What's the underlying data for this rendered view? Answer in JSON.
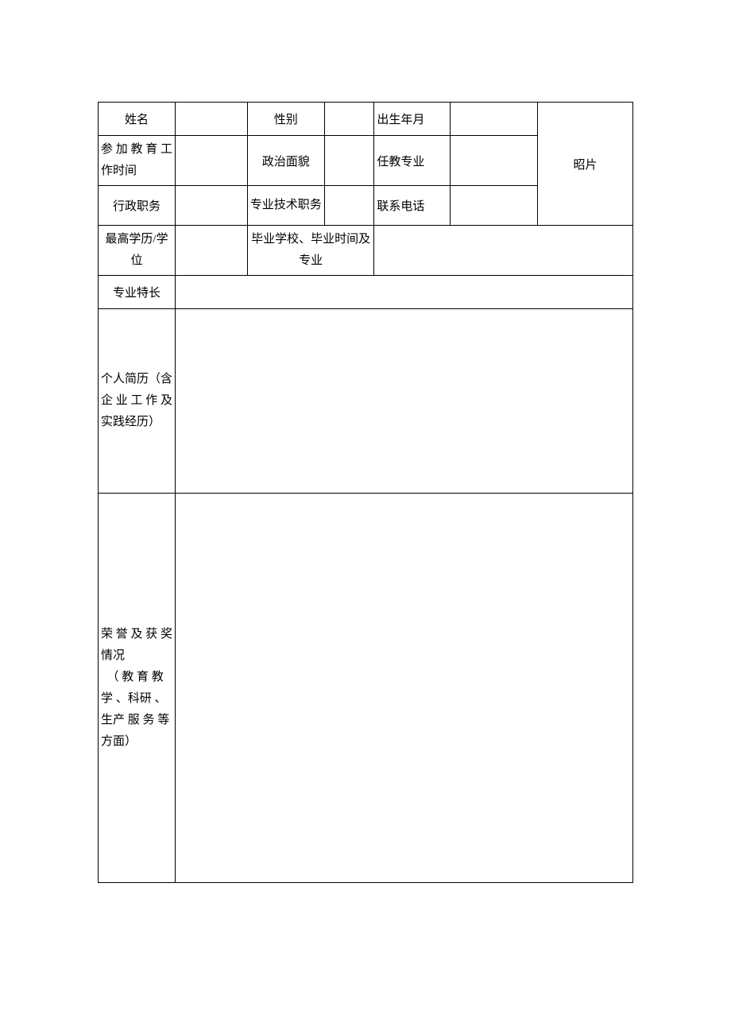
{
  "row1": {
    "name_label": "姓名",
    "gender_label": "性别",
    "birth_label": "出生年月"
  },
  "row2": {
    "edu_work_label": "参 加 教 育 工作时间",
    "political_label": "政治面貌",
    "major_label": "任教专业"
  },
  "row3": {
    "admin_label": "行政职务",
    "prof_title_label": "专业技术职务",
    "phone_label": "联系电话"
  },
  "row4": {
    "degree_label": "最高学历/学位",
    "grad_label": "毕业学校、毕业时间及专业"
  },
  "row5": {
    "specialty_label": "专业特长"
  },
  "row6": {
    "resume_label": "个人简历（含企 业 工 作 及实践经历）"
  },
  "row7": {
    "honors_line1": "荣 誉 及 获 奖情况",
    "honors_line2": "　（ 教 育 教学 、科研 、生产 服 务 等 方面）"
  },
  "photo_label": "昭片"
}
